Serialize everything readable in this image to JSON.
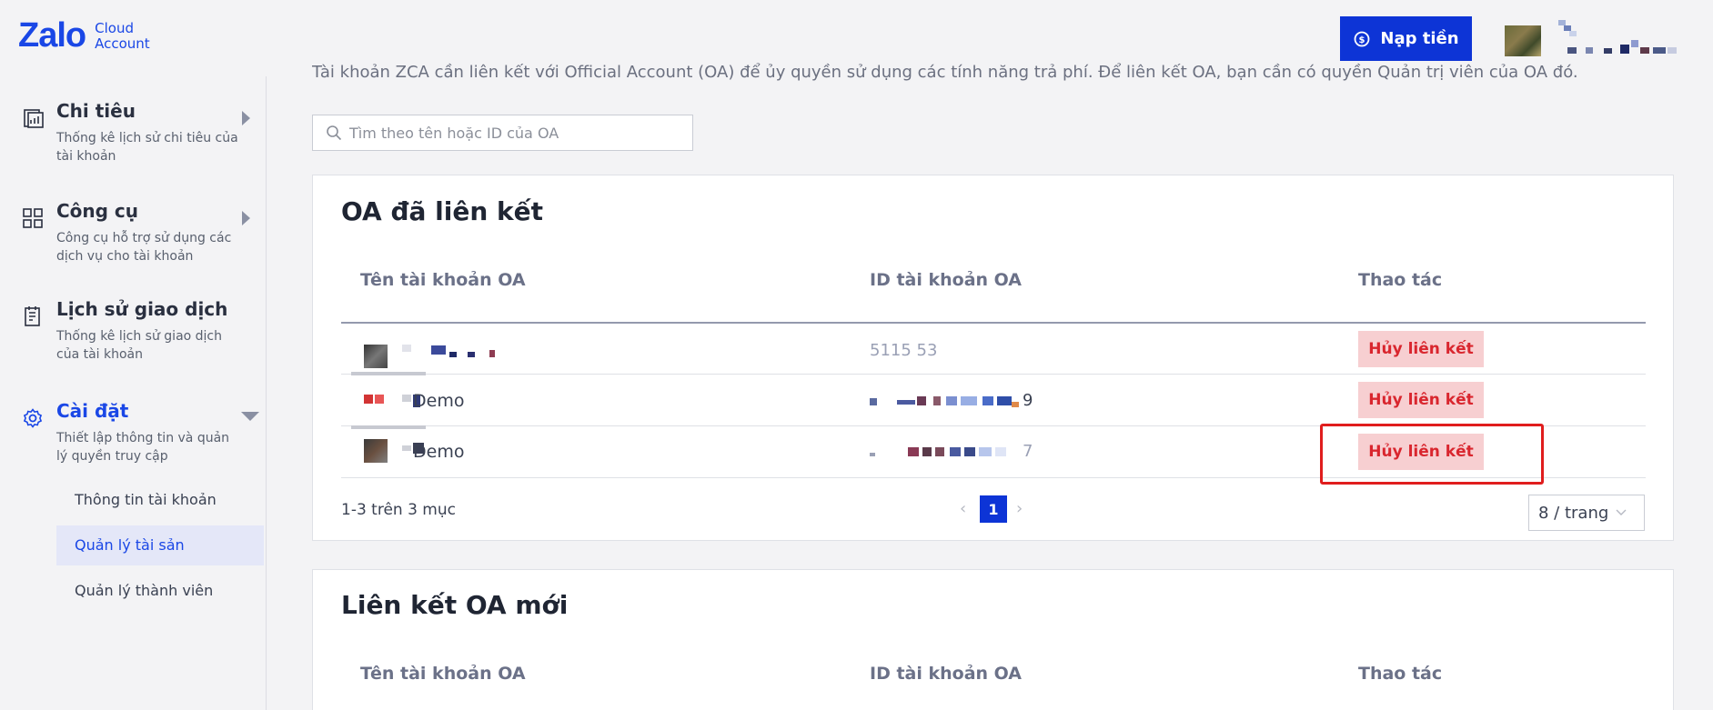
{
  "header": {
    "logo_main": "Zalo",
    "logo_sub_1": "Cloud",
    "logo_sub_2": "Account",
    "topup_label": "Nạp tiền",
    "accent": "#0d34d6"
  },
  "sidebar": {
    "menus": [
      {
        "title": "Chi tiêu",
        "desc": "Thống kê lịch sử chi tiêu của tài khoản",
        "icon": "report-icon"
      },
      {
        "title": "Công cụ",
        "desc": "Công cụ hỗ trợ sử dụng các dịch vụ cho tài khoản",
        "icon": "tools-grid-icon"
      },
      {
        "title": "Lịch sử giao dịch",
        "desc": "Thống kê lịch sử giao dịch của tài khoản",
        "icon": "transaction-history-icon"
      },
      {
        "title": "Cài đặt",
        "desc": "Thiết lập thông tin và quản lý quyền truy cập",
        "icon": "gear-icon"
      }
    ],
    "sub_items": [
      "Thông tin tài khoản",
      "Quản lý tài sản",
      "Quản lý thành viên"
    ],
    "active_sub": "Quản lý tài sản"
  },
  "content": {
    "intro": "Tài khoản ZCA cần liên kết với Official Account (OA) để ủy quyền sử dụng các tính năng trả phí. Để liên kết OA, bạn cần có quyền Quản trị viên của OA đó.",
    "search_placeholder": "Tìm theo tên hoặc ID của OA",
    "linked": {
      "title": "OA đã liên kết",
      "columns": [
        "Tên tài khoản OA",
        "ID tài khoản OA",
        "Thao tác"
      ],
      "rows": [
        {
          "name": "",
          "id": "5115                53",
          "action": "Hủy liên kết"
        },
        {
          "name": "Demo",
          "id": "9",
          "action": "Hủy liên kết"
        },
        {
          "name": "Demo",
          "id": "7",
          "action": "Hủy liên kết"
        }
      ],
      "pagination": {
        "info": "1-3 trên 3 mục",
        "current": "1",
        "page_size": "8 / trang"
      }
    },
    "new_link": {
      "title": "Liên kết OA mới",
      "columns": [
        "Tên tài khoản OA",
        "ID tài khoản OA",
        "Thao tác"
      ]
    }
  }
}
